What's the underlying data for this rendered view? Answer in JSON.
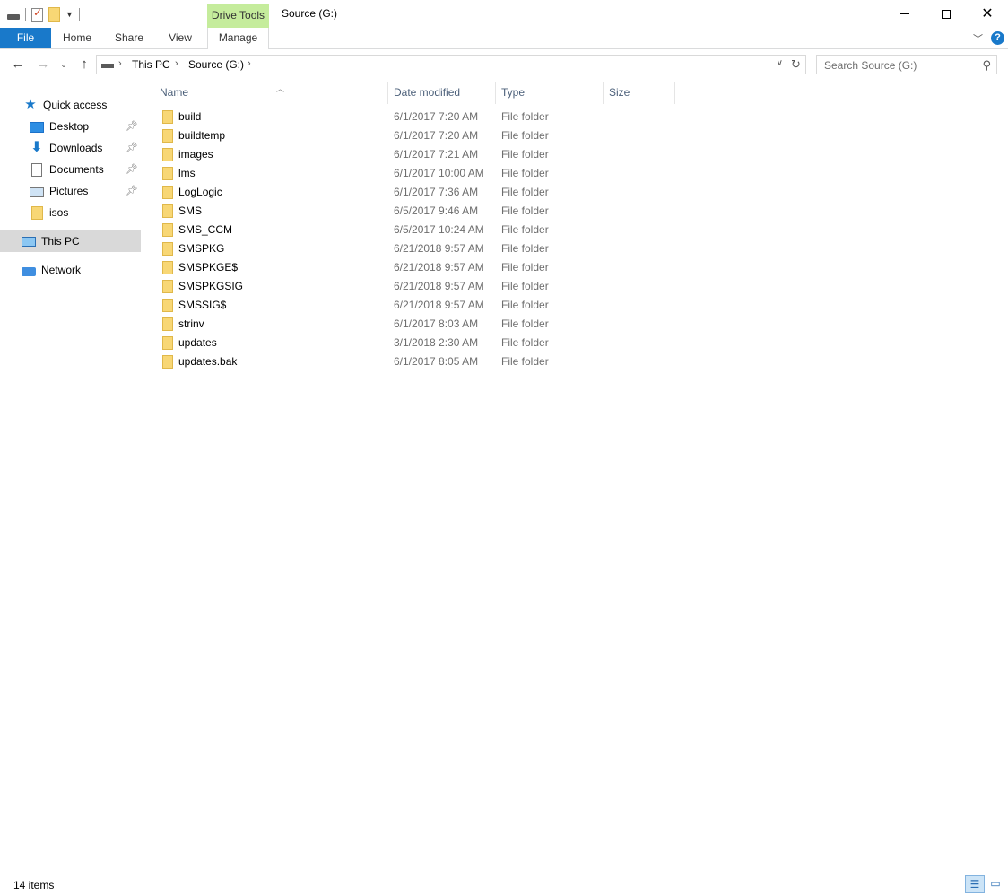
{
  "window": {
    "title": "Source (G:)",
    "contextual_tab_group": "Drive Tools"
  },
  "ribbon": {
    "tabs": [
      {
        "label": "File"
      },
      {
        "label": "Home"
      },
      {
        "label": "Share"
      },
      {
        "label": "View"
      },
      {
        "label": "Manage"
      }
    ],
    "help_label": "?"
  },
  "address": {
    "segments": [
      "This PC",
      "Source (G:)"
    ]
  },
  "search": {
    "placeholder": "Search Source (G:)"
  },
  "nav_pane": {
    "items": [
      {
        "label": "Quick access",
        "icon": "star-icon"
      },
      {
        "label": "Desktop",
        "icon": "desktop-icon",
        "pinned": true
      },
      {
        "label": "Downloads",
        "icon": "download-icon",
        "pinned": true
      },
      {
        "label": "Documents",
        "icon": "documents-icon",
        "pinned": true
      },
      {
        "label": "Pictures",
        "icon": "pictures-icon",
        "pinned": true
      },
      {
        "label": "isos",
        "icon": "folder-icon"
      },
      {
        "label": "This PC",
        "icon": "computer-icon",
        "selected": true
      },
      {
        "label": "Network",
        "icon": "network-icon"
      }
    ]
  },
  "columns": {
    "name": "Name",
    "date": "Date modified",
    "type": "Type",
    "size": "Size"
  },
  "files": [
    {
      "name": "build",
      "date": "6/1/2017 7:20 AM",
      "type": "File folder"
    },
    {
      "name": "buildtemp",
      "date": "6/1/2017 7:20 AM",
      "type": "File folder"
    },
    {
      "name": "images",
      "date": "6/1/2017 7:21 AM",
      "type": "File folder"
    },
    {
      "name": "lms",
      "date": "6/1/2017 10:00 AM",
      "type": "File folder"
    },
    {
      "name": "LogLogic",
      "date": "6/1/2017 7:36 AM",
      "type": "File folder"
    },
    {
      "name": "SMS",
      "date": "6/5/2017 9:46 AM",
      "type": "File folder"
    },
    {
      "name": "SMS_CCM",
      "date": "6/5/2017 10:24 AM",
      "type": "File folder"
    },
    {
      "name": "SMSPKG",
      "date": "6/21/2018 9:57 AM",
      "type": "File folder"
    },
    {
      "name": "SMSPKGE$",
      "date": "6/21/2018 9:57 AM",
      "type": "File folder"
    },
    {
      "name": "SMSPKGSIG",
      "date": "6/21/2018 9:57 AM",
      "type": "File folder"
    },
    {
      "name": "SMSSIG$",
      "date": "6/21/2018 9:57 AM",
      "type": "File folder"
    },
    {
      "name": "strinv",
      "date": "6/1/2017 8:03 AM",
      "type": "File folder"
    },
    {
      "name": "updates",
      "date": "3/1/2018 2:30 AM",
      "type": "File folder"
    },
    {
      "name": "updates.bak",
      "date": "6/1/2017 8:05 AM",
      "type": "File folder"
    }
  ],
  "status": {
    "item_count": "14 items"
  },
  "colors": {
    "accent": "#1979ca",
    "drive_tools": "#c5ec9c",
    "folder": "#f8d775",
    "selected_nav": "#d9d9d9"
  }
}
